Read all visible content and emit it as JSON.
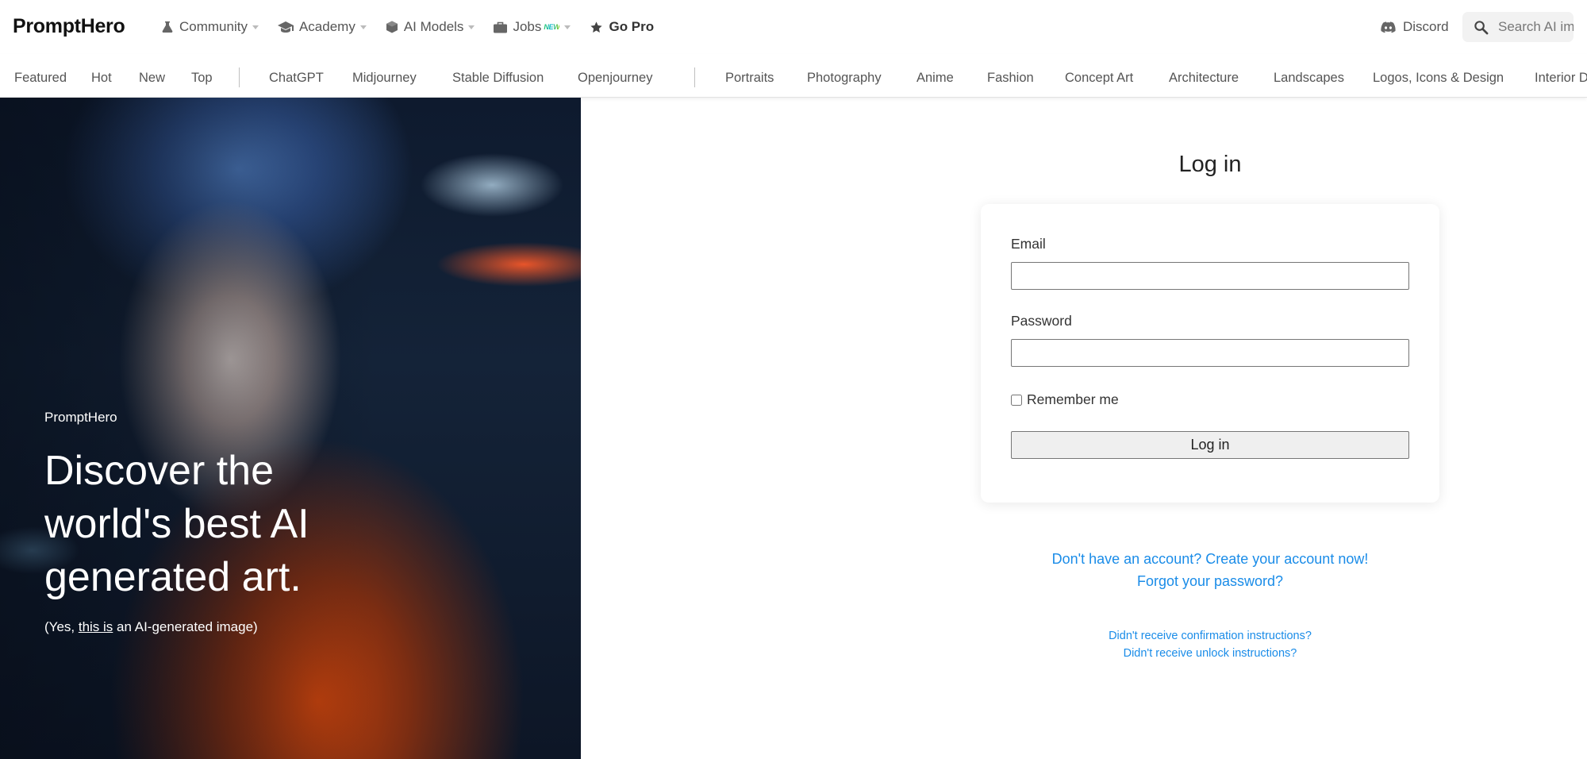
{
  "brand": "PromptHero",
  "topnav": [
    {
      "label": "Community",
      "icon": "flask-icon",
      "dropdown": true
    },
    {
      "label": "Academy",
      "icon": "graduation-cap-icon",
      "dropdown": true
    },
    {
      "label": "AI Models",
      "icon": "cube-icon",
      "dropdown": true
    },
    {
      "label": "Jobs",
      "badge": "NEW",
      "icon": "briefcase-icon",
      "dropdown": true
    },
    {
      "label": "Go Pro",
      "icon": "star-icon"
    }
  ],
  "discord": "Discord",
  "search": {
    "placeholder": "Search AI images..."
  },
  "categories": {
    "sort": [
      "Featured",
      "Hot",
      "New",
      "Top"
    ],
    "models": [
      "ChatGPT",
      "Midjourney",
      "Stable Diffusion",
      "Openjourney"
    ],
    "topics": [
      "Portraits",
      "Photography",
      "Anime",
      "Fashion",
      "Concept Art",
      "Architecture",
      "Landscapes",
      "Logos, Icons & Design",
      "Interior D"
    ]
  },
  "hero": {
    "subtitle": "PromptHero",
    "title": "Discover the world's best AI generated art.",
    "caption_prefix": "(Yes, ",
    "caption_link": "this is",
    "caption_suffix": " an AI-generated image)"
  },
  "login": {
    "title": "Log in",
    "email_label": "Email",
    "email_value": "",
    "password_label": "Password",
    "password_value": "",
    "remember_label": "Remember me",
    "remember_checked": false,
    "submit_label": "Log in"
  },
  "links": {
    "signup": "Don't have an account? Create your account now!",
    "forgot": "Forgot your password?",
    "confirmation": "Didn't receive confirmation instructions?",
    "unlock": "Didn't receive unlock instructions?"
  },
  "colors": {
    "link": "#1a8ce8",
    "text": "#212529",
    "nav_text": "#555555"
  }
}
